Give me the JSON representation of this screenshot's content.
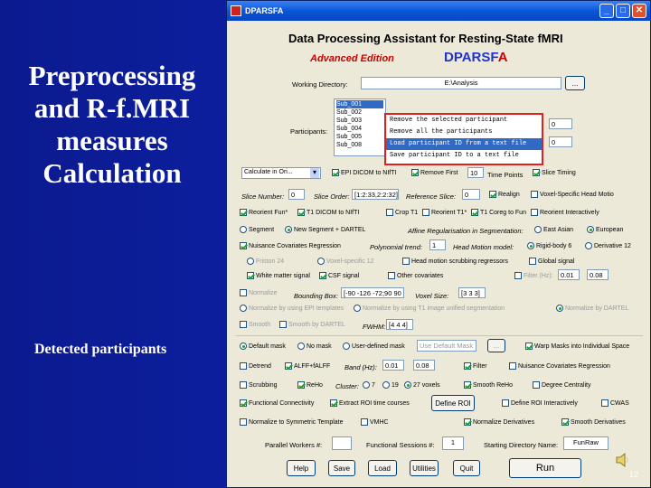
{
  "slide": {
    "title": "Preprocessing and R-f.MRI measures Calculation",
    "caption": "Detected participants",
    "page_number": "12"
  },
  "window": {
    "title": "DPARSFA",
    "heading": "Data Processing Assistant for Resting-State fMRI",
    "edition": "Advanced Edition",
    "logo_main": "DPARSF",
    "logo_suffix": "A",
    "titlebar_buttons": [
      "_",
      "□",
      "✕"
    ]
  },
  "working_dir": {
    "label": "Working Directory:",
    "value": "E:\\Analysis",
    "browse": "..."
  },
  "participants": {
    "label": "Participants:",
    "items": [
      "Sub_001",
      "Sub_002",
      "Sub_003",
      "Sub_004",
      "Sub_005",
      "Sub_008"
    ],
    "selected_index": 0
  },
  "context_menu": {
    "items": [
      "Remove the selected participant",
      "Remove all the participants",
      "Load participant ID from a text file",
      "Save participant ID to a text file"
    ],
    "highlight_index": 2
  },
  "timepoints": {
    "value_1": "0",
    "value_2": "0"
  },
  "row1": {
    "calc_select": "Calculate in Ori...",
    "epi_dicom": "EPI DICOM to NIfTI",
    "remove_first": "Remove First",
    "remove_first_value": "10",
    "time_points": "Time Points",
    "slice_timing": "Slice Timing"
  },
  "row2": {
    "slice_number": "Slice Number:",
    "slice_number_value": "0",
    "slice_order": "Slice Order:",
    "slice_order_value": "[1:2:33,2:2:32]",
    "reference_slice": "Reference Slice:",
    "reference_slice_value": "0",
    "realign": "Realign",
    "voxel_specific": "Voxel-Specific Head Motio"
  },
  "row3": {
    "reorient_fun": "Reorient Fun*",
    "t1_dicom": "T1 DICOM to NIfTI",
    "crop_t1": "Crop T1",
    "reorient_t1": "Reorient T1*",
    "t1_coreg": "T1 Coreg to Fun",
    "reorient_interactive": "Reorient Interactively"
  },
  "row4": {
    "segment": "Segment",
    "new_segment": "New Segment + DARTEL",
    "affine_reg": "Affine Regularisation in Segmentation:",
    "east_asian": "East Asian",
    "european": "European"
  },
  "row5": {
    "nuisance": "Nuisance Covariates Regression",
    "polynomial": "Polynomial trend:",
    "polynomial_value": "1",
    "head_motion_model": "Head Motion model:",
    "rigid": "Rigid-body 6",
    "derivative": "Derivative 12"
  },
  "row6": {
    "friston": "Friston 24",
    "voxel_specific12": "Voxel-specific 12",
    "head_motion_scrub": "Head motion scrubbing regressors",
    "global_signal": "Global signal"
  },
  "row7": {
    "wm": "White matter signal",
    "csf": "CSF signal",
    "other_cov": "Other covariates",
    "filter_label": "Filter (Hz):",
    "filter_low": "0.01",
    "filter_high": "0.08"
  },
  "row8": {
    "normalize": "Normalize",
    "bounding_box": "Bounding Box:",
    "bounding_box_value": "[-90 -126 -72;90 90 108]",
    "voxel_size": "Voxel Size:",
    "voxel_size_value": "[3 3 3]"
  },
  "row9": {
    "by_epi": "Normalize by using EPI templates",
    "by_t1": "Normalize by using T1 image unified segmentation",
    "by_dartel": "Normalize by DARTEL"
  },
  "row10": {
    "smooth": "Smooth",
    "smooth_dartel": "Smooth by DARTEL",
    "fwhm": "FWHM:",
    "fwhm_value": "[4 4 4]"
  },
  "row11": {
    "default_mask": "Default mask",
    "no_mask": "No mask",
    "user_mask": "User-defined mask",
    "user_mask_value": "Use Default Mask",
    "browse": "...",
    "warp_masks": "Warp Masks into Individual Space"
  },
  "row12": {
    "detrend": "Detrend",
    "alff": "ALFF+fALFF",
    "band": "Band (Hz):",
    "band_low": "0.01",
    "band_high": "0.08",
    "filter": "Filter",
    "nuisance_reg": "Nuisance Covariates Regression"
  },
  "row13": {
    "scrubbing": "Scrubbing",
    "reho": "ReHo",
    "cluster": "Cluster:",
    "c7": "7",
    "c19": "19",
    "c27": "27 voxels",
    "smooth_reho": "Smooth ReHo",
    "degree": "Degree Centrality"
  },
  "row14": {
    "fc": "Functional Connectivity",
    "extract_roi": "Extract ROI time courses",
    "define_roi": "Define ROI",
    "define_roi_inter": "Define ROI Interactively",
    "cwas": "CWAS"
  },
  "row15": {
    "normalize_template": "Normalize to Symmetric Template",
    "vmhc": "VMHC",
    "normalize_derivatives": "Normalize Derivatives",
    "smooth_derivatives": "Smooth Derivatives"
  },
  "row16": {
    "parallel_workers": "Parallel Workers #:",
    "parallel_value": "",
    "functional_sessions": "Functional Sessions #:",
    "functional_value": "1",
    "start_dir": "Starting Directory Name:",
    "start_dir_value": "FunRaw"
  },
  "buttons": {
    "help": "Help",
    "save": "Save",
    "load": "Load",
    "utilities": "Utilities",
    "quit": "Quit",
    "run": "Run"
  },
  "colors": {
    "slide_bg": "#0c1a8c",
    "window_bg": "#ece9d8",
    "accent": "#316ac5",
    "highlight_box": "#e02020",
    "edition_red": "#cc0000"
  }
}
